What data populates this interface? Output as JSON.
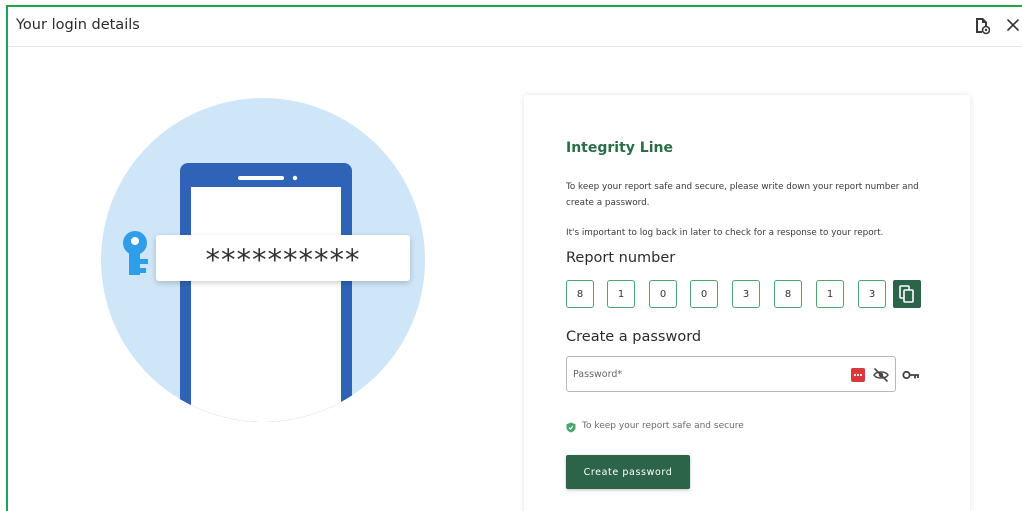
{
  "window": {
    "title": "Your login details"
  },
  "form": {
    "brand": "Integrity Line",
    "description_1": "To keep your report safe and secure, please write down your report number and create a password.",
    "description_2": "It's important to log back in later to check for a response to your report.",
    "report_number_label": "Report number",
    "report_digits": [
      "8",
      "1",
      "0",
      "0",
      "3",
      "8",
      "1",
      "3"
    ],
    "create_password_label": "Create a password",
    "password_placeholder": "Password*",
    "hint": "To keep your report safe and secure",
    "submit_label": "Create password"
  },
  "illustration": {
    "masked_password": "**********"
  },
  "colors": {
    "accent": "#2b6448",
    "brand_text": "#2a6e48",
    "frame_border": "#1ea44a",
    "digit_border": "#4aa56e",
    "password_manager": "#d9383a"
  },
  "icons": [
    "document-settings-icon",
    "close-icon",
    "key-icon",
    "copy-icon",
    "password-manager-icon",
    "eye-off-icon",
    "shield-icon"
  ]
}
